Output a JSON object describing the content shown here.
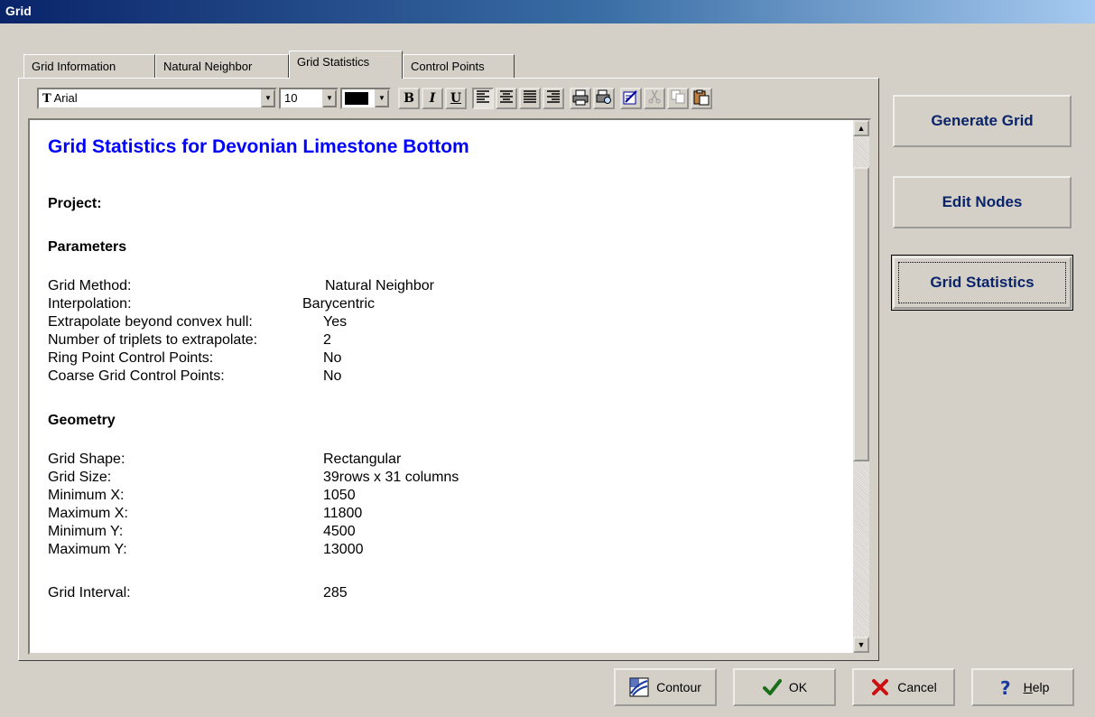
{
  "window": {
    "title": "Grid"
  },
  "tabs": [
    {
      "label": "Grid Information"
    },
    {
      "label": "Natural Neighbor"
    },
    {
      "label": "Grid Statistics",
      "active": true
    },
    {
      "label": "Control Points"
    }
  ],
  "toolbar": {
    "font_name": "Arial",
    "font_size": "10",
    "color_swatch": "#000000",
    "bold_label": "B",
    "italic_label": "I",
    "underline_label": "U",
    "icons": [
      "align-left-icon",
      "align-center-icon",
      "align-justify-icon",
      "align-right-icon",
      "print-icon",
      "print-preview-icon",
      "edit-icon",
      "cut-icon",
      "copy-icon",
      "paste-icon"
    ]
  },
  "report": {
    "title": "Grid Statistics for Devonian Limestone Bottom",
    "project_label": "Project:",
    "parameters_heading": "Parameters",
    "parameters": [
      {
        "key": "Grid Method:",
        "value": "Natural Neighbor"
      },
      {
        "key": "Interpolation:",
        "value": "Barycentric"
      },
      {
        "key": "Extrapolate beyond convex hull:",
        "value": "Yes"
      },
      {
        "key": "Number of triplets to extrapolate:",
        "value": "2"
      },
      {
        "key": "Ring Point Control Points:",
        "value": "No"
      },
      {
        "key": "Coarse Grid Control Points:",
        "value": "No"
      }
    ],
    "geometry_heading": "Geometry",
    "geometry": [
      {
        "key": "Grid Shape:",
        "value": "Rectangular"
      },
      {
        "key": "Grid Size:",
        "value": "39rows x 31 columns"
      },
      {
        "key": "Minimum X:",
        "value": "1050"
      },
      {
        "key": "Maximum X:",
        "value": "11800"
      },
      {
        "key": "Minimum Y:",
        "value": "4500"
      },
      {
        "key": "Maximum Y:",
        "value": "13000"
      }
    ],
    "interval": {
      "key": "Grid Interval:",
      "value": "285"
    }
  },
  "side_buttons": {
    "generate": "Generate Grid",
    "edit_nodes": "Edit Nodes",
    "statistics": "Grid Statistics"
  },
  "bottom_buttons": {
    "contour": "Contour",
    "ok": "OK",
    "cancel": "Cancel",
    "help_prefix": "",
    "help_hotkey": "H",
    "help_rest": "elp"
  },
  "colors": {
    "title_blue": "#0000ff",
    "button_text": "#0a246a",
    "ok_check": "#1a6e1a",
    "cancel_x": "#cc1010"
  }
}
